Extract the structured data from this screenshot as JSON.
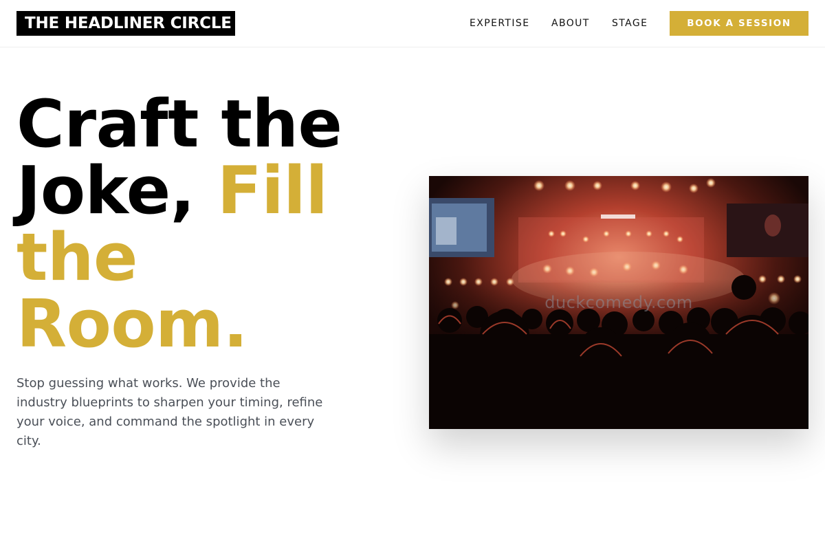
{
  "brand": {
    "logo": "THE HEADLINER CIRCLE"
  },
  "nav": {
    "links": [
      "EXPERTISE",
      "ABOUT",
      "STAGE"
    ],
    "cta": "BOOK A SESSION"
  },
  "hero": {
    "title_part1": "Craft the",
    "title_part2": "Joke,",
    "title_accent1": "Fill",
    "title_accent2": "the",
    "title_accent3": "Room.",
    "description": "Stop guessing what works. We provide the industry blueprints to sharpen your timing, refine your voice, and command the spotlight in every city.",
    "image_watermark": "duckcomedy.com"
  },
  "colors": {
    "accent": "#d4af37",
    "text_dark": "#000000",
    "text_muted": "#4a4f57"
  },
  "icons": {
    "hero_image": "concert-crowd-stage-photo"
  }
}
